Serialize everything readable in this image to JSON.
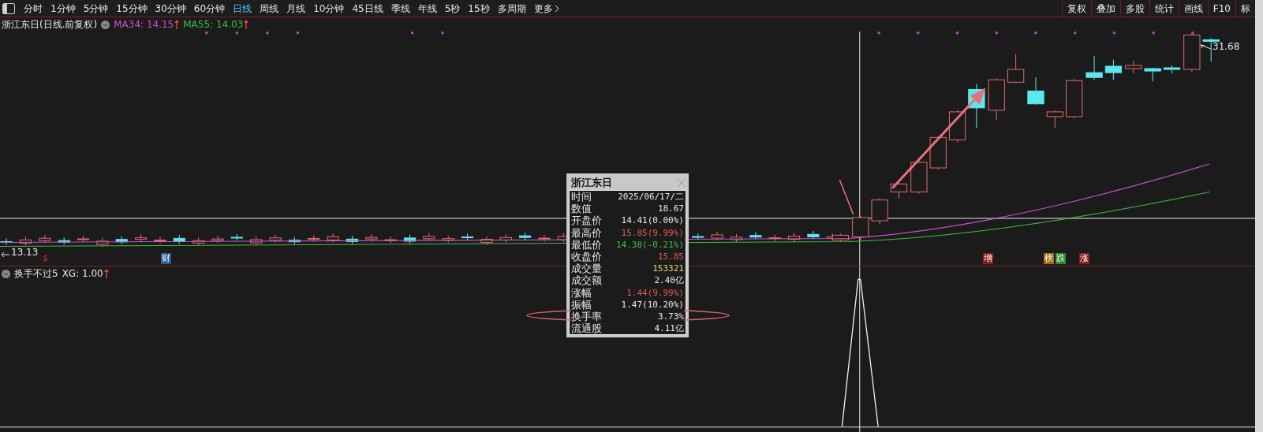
{
  "toolbar": {
    "periods": [
      {
        "label": "分时",
        "selected": false
      },
      {
        "label": "1分钟",
        "selected": false
      },
      {
        "label": "5分钟",
        "selected": false
      },
      {
        "label": "15分钟",
        "selected": false
      },
      {
        "label": "30分钟",
        "selected": false
      },
      {
        "label": "60分钟",
        "selected": false
      },
      {
        "label": "日线",
        "selected": true
      },
      {
        "label": "周线",
        "selected": false
      },
      {
        "label": "月线",
        "selected": false
      },
      {
        "label": "10分钟",
        "selected": false
      },
      {
        "label": "45日线",
        "selected": false
      },
      {
        "label": "季线",
        "selected": false
      },
      {
        "label": "年线",
        "selected": false
      },
      {
        "label": "5秒",
        "selected": false
      },
      {
        "label": "15秒",
        "selected": false
      },
      {
        "label": "多周期",
        "selected": false
      }
    ],
    "more": "更多",
    "tools": [
      "复权",
      "叠加",
      "多股",
      "统计",
      "画线",
      "F10",
      "标"
    ]
  },
  "chart": {
    "title": "浙江东日(日线.前复权)",
    "averages": [
      {
        "label": "MA34: 14.15",
        "color": "#d04fd0"
      },
      {
        "label": "MA55: 14.03",
        "color": "#3fbf3f"
      }
    ],
    "high_label": "31.68",
    "low_label": "13.13",
    "markers": [
      {
        "text": "$",
        "kind": "glyph",
        "color": "#c8302c"
      },
      {
        "text": "财",
        "kind": "tag",
        "color": "#2a5a9a"
      },
      {
        "text": "增",
        "kind": "tag",
        "color": "#8a1c1c"
      },
      {
        "text": "榜",
        "kind": "tag",
        "color": "#a06a10"
      },
      {
        "text": "跌",
        "kind": "tag",
        "color": "#2a8a2a"
      },
      {
        "text": "涨",
        "kind": "tag",
        "color": "#8a1c1c"
      }
    ]
  },
  "indicator": {
    "name": "换手不过5",
    "value": "XG: 1.00"
  },
  "tooltip": {
    "title": "浙江东日",
    "rows": [
      {
        "label": "时间",
        "value": "2025/06/17/二",
        "color": "#e8e8e8"
      },
      {
        "label": "数值",
        "value": "18.67",
        "color": "#e8e8e8"
      },
      {
        "label": "开盘价",
        "value": "14.41(0.00%)",
        "color": "#e8e8e8"
      },
      {
        "label": "最高价",
        "value": "15.85(9.99%)",
        "color": "#e05a5a"
      },
      {
        "label": "最低价",
        "value": "14.38(-0.21%)",
        "color": "#3fc03f"
      },
      {
        "label": "收盘价",
        "value": "15.85",
        "color": "#e05a5a"
      },
      {
        "label": "成交量",
        "value": "153321",
        "color": "#e0d070"
      },
      {
        "label": "成交额",
        "value": "2.40亿",
        "color": "#e8e8e8"
      },
      {
        "label": "涨幅",
        "value": "1.44(9.99%)",
        "color": "#e05a5a"
      },
      {
        "label": "振幅",
        "value": "1.47(10.20%)",
        "color": "#e8e8e8"
      },
      {
        "label": "换手率",
        "value": "3.73%",
        "color": "#e8e8e8"
      },
      {
        "label": "流通股",
        "value": "4.11亿",
        "color": "#e8e8e8"
      }
    ]
  }
}
